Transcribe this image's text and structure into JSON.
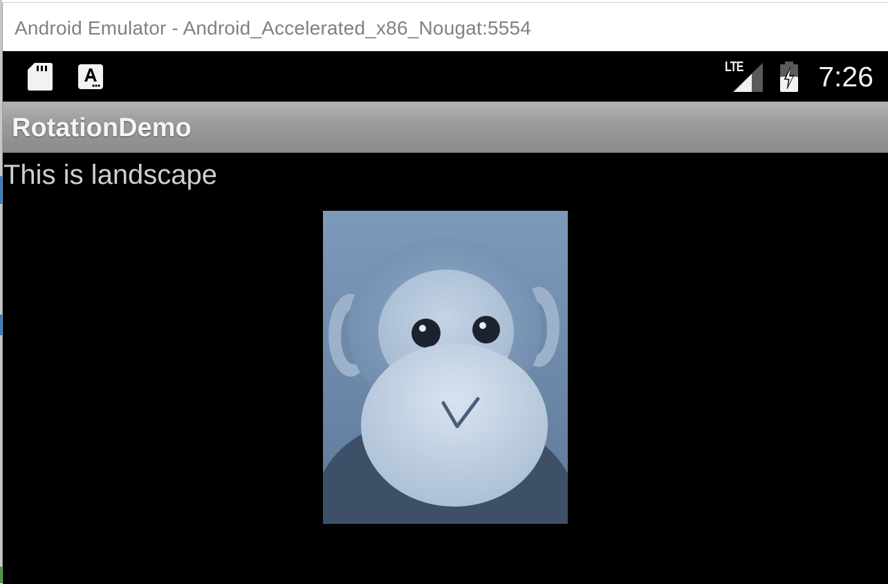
{
  "window": {
    "title": "Android Emulator - Android_Accelerated_x86_Nougat:5554"
  },
  "status_bar": {
    "left_icons": [
      "sd-card-icon",
      "keyboard-a-icon"
    ],
    "network_label": "LTE",
    "right_icons": [
      "signal-icon",
      "battery-charging-icon"
    ],
    "time": "7:26"
  },
  "action_bar": {
    "title": "RotationDemo"
  },
  "content": {
    "text": "This is landscape",
    "image": "monkey-image"
  },
  "colors": {
    "screen_background": "#000000",
    "action_bar": "#9a9a9a",
    "text": "#cfcfcf",
    "image_tint": "#7a95b5"
  }
}
